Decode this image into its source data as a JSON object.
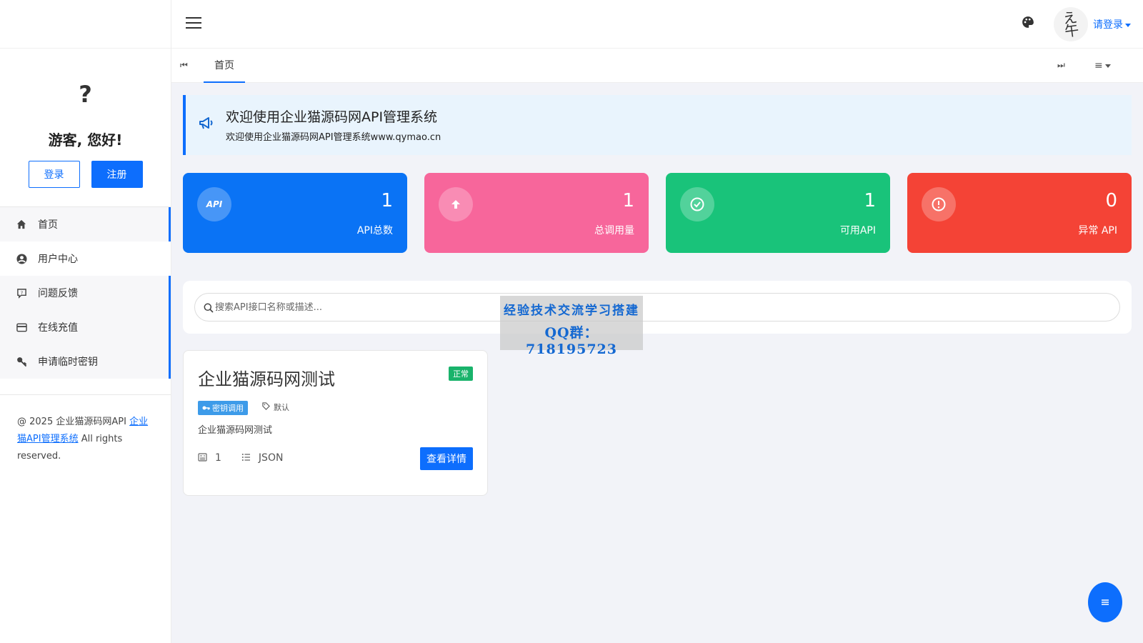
{
  "sidebar": {
    "guest_avatar": "?",
    "greeting": "游客, 您好!",
    "login_label": "登录",
    "register_label": "注册",
    "items": [
      {
        "label": "首页",
        "icon": "home-icon"
      },
      {
        "label": "用户中心",
        "icon": "user-circle-icon"
      },
      {
        "label": "问题反馈",
        "icon": "feedback-icon"
      },
      {
        "label": "在线充值",
        "icon": "credit-card-icon"
      },
      {
        "label": "申请临时密钥",
        "icon": "key-icon"
      }
    ],
    "footer": {
      "copyright": "@ 2025 企业猫源码网API ",
      "link_text": "企业猫API管理系统",
      "suffix": " All rights reserved."
    }
  },
  "header": {
    "avatar_text": "え\n午",
    "login_link": "请登录"
  },
  "tabs": {
    "home": "首页"
  },
  "notice": {
    "title": "欢迎使用企业猫源码网API管理系统",
    "text": "欢迎使用企业猫源码网API管理系统www.qymao.cn"
  },
  "stats": [
    {
      "icon_text": "API",
      "value": "1",
      "label": "API总数",
      "color": "#0a73f5"
    },
    {
      "icon_text": "",
      "value": "1",
      "label": "总调用量",
      "color": "#f7669b"
    },
    {
      "icon_text": "",
      "value": "1",
      "label": "可用API",
      "color": "#19c37a"
    },
    {
      "icon_text": "",
      "value": "0",
      "label": "异常 API",
      "color": "#f44336"
    }
  ],
  "search": {
    "placeholder": "搜索API接口名称或描述..."
  },
  "watermark": {
    "line1": "经验技术交流学习搭建",
    "line2": "QQ群：718195723"
  },
  "api_card": {
    "name": "企业猫源码网测试",
    "status": "正常",
    "auth_type": "密钥调用",
    "tag": "默认",
    "description": "企业猫源码网测试",
    "count": "1",
    "format": "JSON",
    "detail_button": "查看详情"
  }
}
